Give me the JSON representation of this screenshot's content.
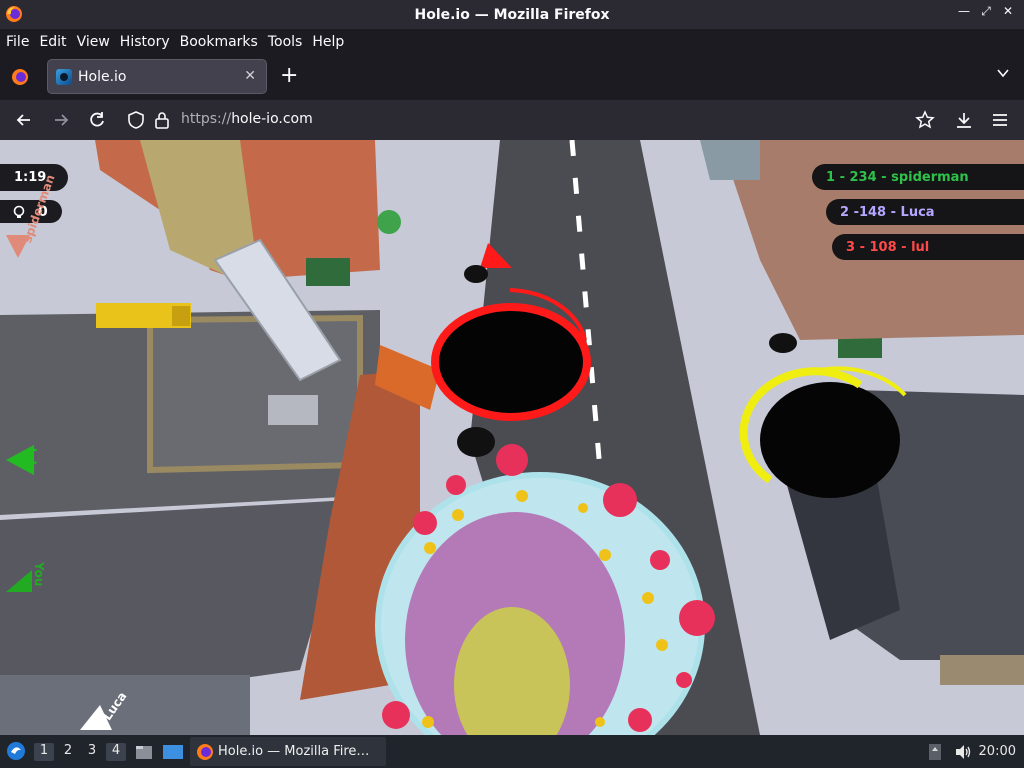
{
  "window": {
    "title": "Hole.io — Mozilla Firefox"
  },
  "menu": {
    "file": "File",
    "edit": "Edit",
    "view": "View",
    "history": "History",
    "bookmarks": "Bookmarks",
    "tools": "Tools",
    "help": "Help"
  },
  "tab": {
    "label": "Hole.io",
    "close_icon": "close-icon"
  },
  "url": {
    "protocol": "https://",
    "host": "hole-io.com"
  },
  "game": {
    "timer": "1:19",
    "score": "0",
    "leaderboard": [
      {
        "text": "1 - 234 - spiderman",
        "color": "#2ec24a"
      },
      {
        "text": "2 -148 - Luca",
        "color": "#b6a6ff"
      },
      {
        "text": "3 - 108 - lul",
        "color": "#ff4a4a"
      }
    ],
    "offscreen": [
      {
        "name": "spiderman",
        "color": "#e08a7a"
      },
      {
        "name": "lul",
        "color": "#22bb22"
      },
      {
        "name": "You",
        "color": "#22aa22"
      },
      {
        "name": "Luca",
        "color": "#ffffff"
      }
    ],
    "colors": {
      "red_hole": "#ff1a1a",
      "yellow_hole": "#f0ee10",
      "ring": "#bfe6ee",
      "cone": "#b47ab8",
      "cone_tip": "#c8c45a"
    }
  },
  "taskbar": {
    "workspaces": [
      "1",
      "2",
      "3",
      "4"
    ],
    "active_workspace": "4",
    "task_label": "Hole.io — Mozilla Fire…",
    "clock": "20:00"
  }
}
